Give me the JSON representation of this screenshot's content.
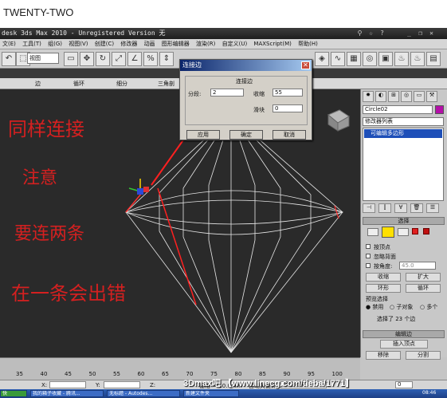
{
  "page": {
    "heading": "TWENTY-TWO"
  },
  "app": {
    "title": "desk 3ds Max  2010  - Unregistered Version  无",
    "menu": [
      "文(E)",
      "工具(T)",
      "组(G)",
      "视图(V)",
      "创建(C)",
      "修改器",
      "动画",
      "图形编辑器",
      "渲染(R)",
      "自定义(U)",
      "MAXScript(M)",
      "帮助(H)"
    ],
    "toolbar": {
      "view_select": "视图"
    },
    "ribbon_tabs": [
      "",
      "边",
      "循环",
      "细分",
      "三角剖"
    ]
  },
  "dialog": {
    "title": "连接边",
    "group_title": "连接边",
    "segments_label": "分段:",
    "segments_value": "2",
    "pinch_label": "收缩",
    "pinch_value": "55",
    "slide_label": "滑块",
    "slide_value": "0",
    "apply_label": "应用",
    "ok_label": "确定",
    "cancel_label": "取消"
  },
  "viewport": {
    "annotation_lines": [
      "同样连接",
      "注意",
      "要连两条",
      "在一条会出错"
    ],
    "annotation_color": "#d42020"
  },
  "command_panel": {
    "object_name": "Circle02",
    "object_color": "#b40fa8",
    "modifier_list_label": "修改器列表",
    "stack_item": "可编辑多边形",
    "selection_rollout": "选择",
    "by_vertex_label": "按顶点",
    "ignore_backfacing_label": "忽略背面",
    "by_angle_label": "按角度:",
    "by_angle_value": "45.0",
    "shrink_label": "收缩",
    "grow_label": "扩大",
    "ring_label": "环形",
    "loop_label": "循环",
    "preview_label": "预览选择",
    "preview_options": [
      "禁用",
      "子对象",
      "多个"
    ],
    "selected_status": "选择了 23 个边",
    "edit_edges_rollout": "编辑边",
    "insert_vertex_label": "插入顶点",
    "remove_label": "移除",
    "split_label": "分割"
  },
  "timeline": {
    "ticks": [
      "35",
      "40",
      "45",
      "50",
      "55",
      "60",
      "65",
      "70",
      "75",
      "80",
      "85",
      "90",
      "95",
      "100"
    ]
  },
  "status": {
    "x_label": "X:",
    "y_label": "Y:",
    "z_label": "Z:",
    "grid_label": "栅格 = 10.0mm",
    "add_key_label": "添加时间标记",
    "auto_key_label": "自动关键点",
    "set_key_label": "设置关键点",
    "selection_filter": "选定对象",
    "key_filter_label": "关键点过滤器...",
    "frame_value": "0",
    "clock": "08:46"
  },
  "taskbar": {
    "items": [
      "快",
      "我的箱子收藏 - 腾讯...",
      "无标题 - Autodes...",
      "新建文件夹"
    ]
  },
  "watermark": "3Dmax吧 【www.linecg.com/tieba/1771】"
}
